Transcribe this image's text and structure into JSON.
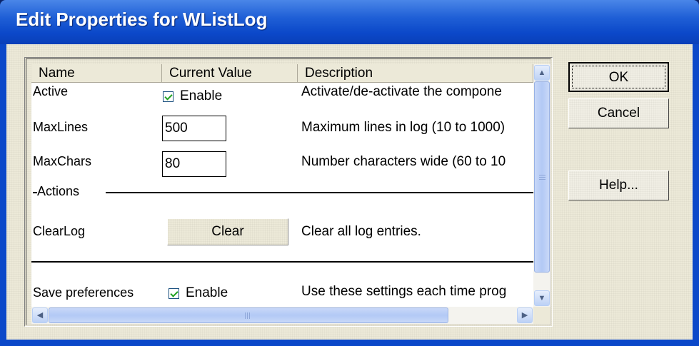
{
  "window": {
    "title": "Edit Properties for WListLog"
  },
  "grid": {
    "columns": [
      "Name",
      "Current Value",
      "Description"
    ],
    "rows": [
      {
        "name": "Active",
        "value": "Enable",
        "checked": true,
        "description": "Activate/de-activate the compone"
      },
      {
        "name": "MaxLines",
        "value": "500",
        "description": "Maximum lines in log (10 to 1000)"
      },
      {
        "name": "MaxChars",
        "value": "80",
        "description": "Number characters wide (60 to 10"
      }
    ],
    "section": "Actions",
    "action": {
      "name": "ClearLog",
      "button": "Clear",
      "description": "Clear all log entries."
    },
    "save": {
      "name": "Save preferences",
      "value": "Enable",
      "checked": true,
      "description": "Use these settings each time prog"
    }
  },
  "buttons": {
    "ok": "OK",
    "cancel": "Cancel",
    "help": "Help..."
  },
  "colors": {
    "titlebar": "#0b48c9",
    "dialog_bg": "#ece9d8",
    "scrollbar_thumb": "#b3c9f5"
  }
}
